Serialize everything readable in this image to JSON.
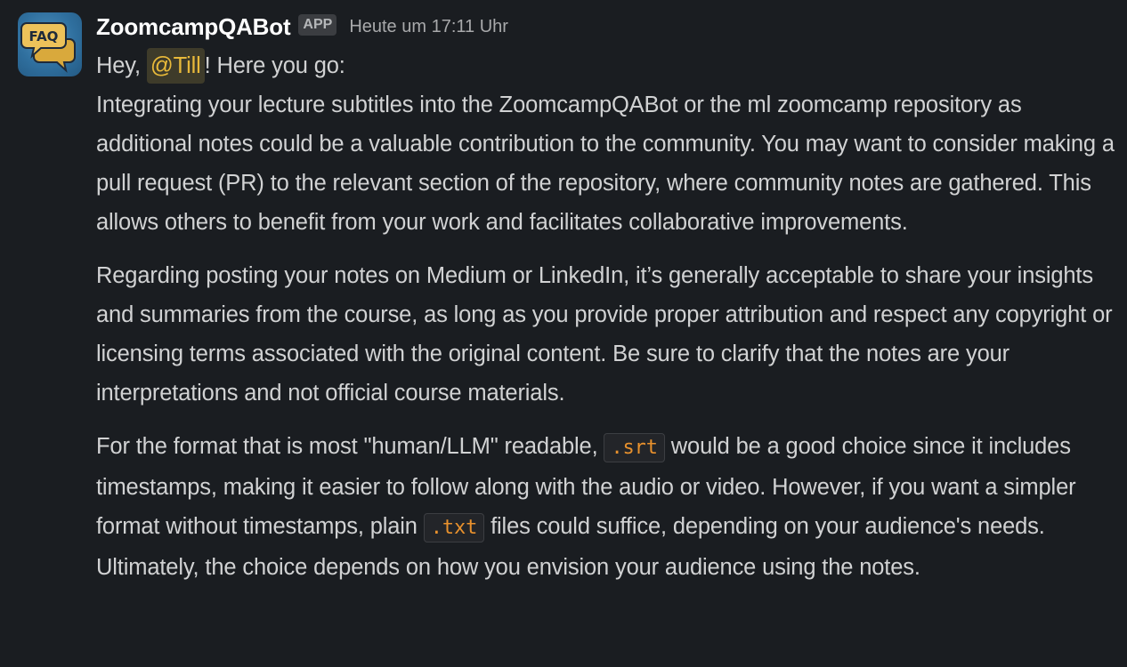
{
  "message": {
    "avatar_icon": "faq-chat-bubbles-icon",
    "avatar_text": "FAQ",
    "sender": "ZoomcampQABot",
    "badge": "APP",
    "timestamp": "Heute um 17:11 Uhr",
    "greeting": {
      "prefix": "Hey, ",
      "mention": "@Till",
      "suffix": "! Here you go:"
    },
    "paragraph1": "Integrating your lecture subtitles into the ZoomcampQABot or the ml zoomcamp repository as additional notes could be a valuable contribution to the community. You may want to consider making a pull request (PR) to the relevant section of the repository, where community notes are gathered. This allows others to benefit from your work and facilitates collaborative improvements.",
    "paragraph2": "Regarding posting your notes on Medium or LinkedIn, it’s generally acceptable to share your insights and summaries from the course, as long as you provide proper attribution and respect any copyright or licensing terms associated with the original content. Be sure to clarify that the notes are your interpretations and not official course materials.",
    "paragraph3": {
      "part1": "For the format that is most \"human/LLM\" readable, ",
      "code1": ".srt",
      "part2": " would be a good choice since it includes timestamps, making it easier to follow along with the audio or video. However, if you want a simpler format without timestamps, plain ",
      "code2": ".txt",
      "part3": " files could suffice, depending on your audience's needs. Ultimately, the choice depends on how you envision your audience using the notes."
    }
  },
  "colors": {
    "background": "#1a1d21",
    "text": "#d1d2d3",
    "mention_text": "#e8b93a",
    "mention_bg": "#3e3b2a",
    "code_text": "#e8912d",
    "avatar_blue": "#2f6f9e",
    "avatar_bubble": "#e9b949"
  }
}
